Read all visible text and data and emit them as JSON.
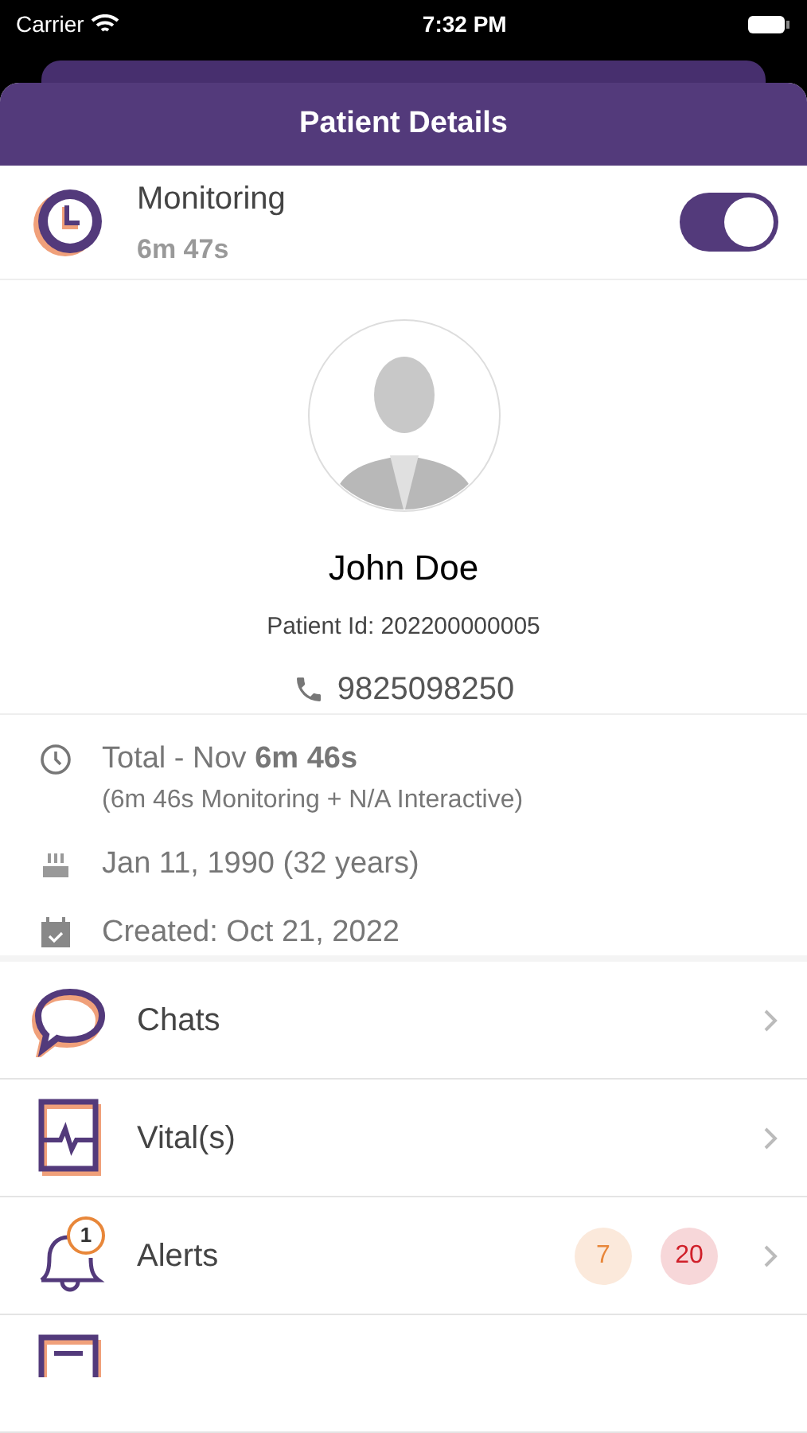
{
  "status_bar": {
    "carrier": "Carrier",
    "time": "7:32 PM"
  },
  "header": {
    "title": "Patient Details"
  },
  "monitoring": {
    "label": "Monitoring",
    "duration": "6m 47s",
    "on": true
  },
  "profile": {
    "name": "John Doe",
    "patient_id": "Patient Id: 202200000005",
    "phone": "9825098250"
  },
  "info": [
    {
      "kind": "time",
      "text": "Total - Nov **6m 46s**",
      "subtext": "(6m 46s Monitoring + N/A Interactive)"
    },
    {
      "kind": "birthday",
      "text": "Jan 11, 1990 (32 years)"
    },
    {
      "kind": "created",
      "text": "Created: Oct 21, 2022"
    }
  ],
  "menu": [
    {
      "kind": "chat",
      "label": "Chats"
    },
    {
      "kind": "vital",
      "label": "Vital(s)"
    },
    {
      "kind": "alert",
      "label": "Alerts",
      "icon_badge": "1",
      "counts": [
        {
          "text": "7",
          "color": "#e8873a"
        },
        {
          "text": "20",
          "color": "#d0202a"
        }
      ]
    },
    {
      "kind": "report"
    }
  ]
}
